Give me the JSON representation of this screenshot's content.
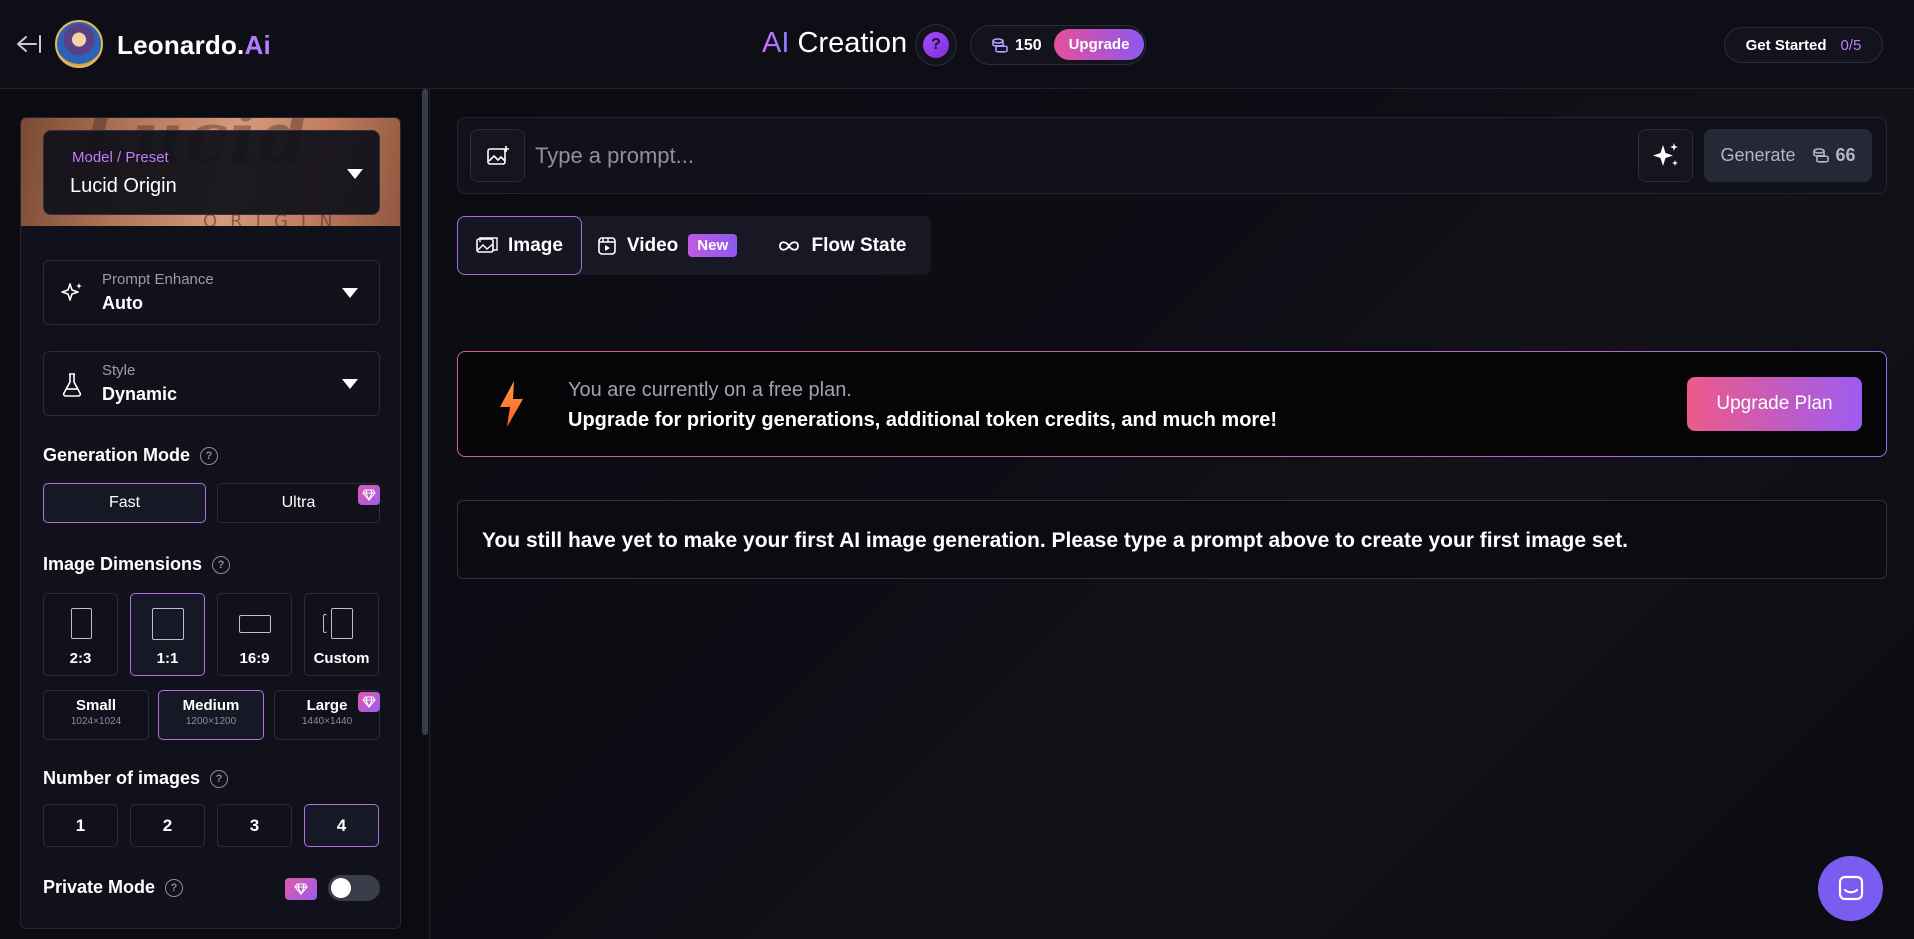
{
  "header": {
    "brand_name": "Leonardo.",
    "brand_suffix": "Ai",
    "title_ai": "AI",
    "title_rest": " Creation",
    "help_label": "?",
    "tokens": "150",
    "upgrade_label": "Upgrade",
    "get_started_label": "Get Started",
    "get_started_progress": "0/5"
  },
  "sidebar": {
    "model_banner_deco": "Lucid",
    "model_banner_deco2": "ORIGIN",
    "model": {
      "label": "Model / Preset",
      "value": "Lucid Origin"
    },
    "prompt_enhance": {
      "label": "Prompt Enhance",
      "value": "Auto"
    },
    "style": {
      "label": "Style",
      "value": "Dynamic"
    },
    "generation_mode": {
      "title": "Generation Mode",
      "options": [
        "Fast",
        "Ultra"
      ],
      "selected": "Fast"
    },
    "image_dimensions": {
      "title": "Image Dimensions",
      "ratios": [
        "2:3",
        "1:1",
        "16:9",
        "Custom"
      ],
      "selected_ratio": "1:1",
      "sizes": [
        {
          "name": "Small",
          "dims": "1024×1024"
        },
        {
          "name": "Medium",
          "dims": "1200×1200"
        },
        {
          "name": "Large",
          "dims": "1440×1440"
        }
      ],
      "selected_size": "Medium"
    },
    "number_of_images": {
      "title": "Number of images",
      "options": [
        "1",
        "2",
        "3",
        "4"
      ],
      "selected": "4"
    },
    "private_mode": {
      "title": "Private Mode",
      "enabled": false
    }
  },
  "main": {
    "prompt": {
      "placeholder": "Type a prompt...",
      "value": ""
    },
    "generate_label": "Generate",
    "generate_cost": "66",
    "tabs": [
      {
        "label": "Image",
        "active": true
      },
      {
        "label": "Video",
        "badge": "New",
        "active": false
      },
      {
        "label": "Flow State",
        "active": false
      }
    ],
    "plan_banner": {
      "line1": "You are currently on a free plan.",
      "line2": "Upgrade for priority generations, additional token credits, and much more!",
      "button": "Upgrade Plan"
    },
    "empty_message": "You still have yet to make your first AI image generation. Please type a prompt above to create your first image set."
  },
  "colors": {
    "accent_purple": "#b06ee0",
    "upgrade_gradient_start": "#e4509b",
    "upgrade_gradient_end": "#8d58f0",
    "chat_bubble": "#7b5cf0"
  },
  "icons": [
    "back-arrow-icon",
    "help-icon",
    "coin-stack-icon",
    "sparkle-icon",
    "flask-icon",
    "gem-icon",
    "image-icon",
    "video-icon",
    "infinity-icon",
    "bolt-icon",
    "chat-icon"
  ]
}
